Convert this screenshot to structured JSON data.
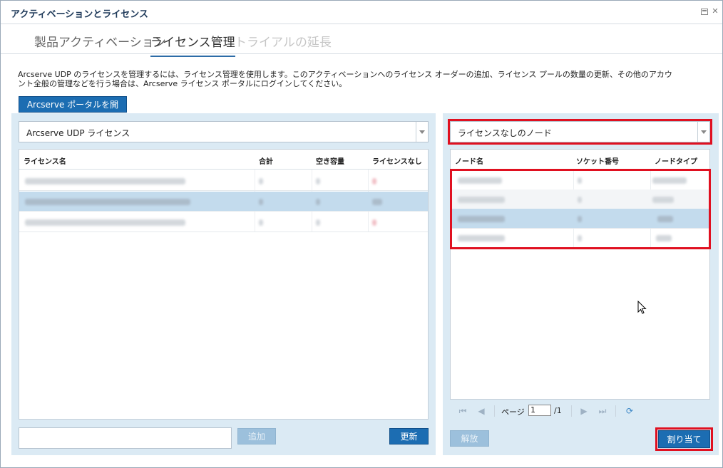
{
  "window": {
    "title": "アクティベーションとライセンス"
  },
  "tabs": [
    {
      "label": "製品アクティベーション"
    },
    {
      "label": "ライセンス管理"
    },
    {
      "label": "トライアルの延長"
    }
  ],
  "description": "Arcserve UDP のライセンスを管理するには、ライセンス管理を使用します。このアクティベーションへのライセンス オーダーの追加、ライセンス プールの数量の更新、その他のアカウント全般の管理などを行う場合は、Arcserve ライセンス ポータルにログインしてください。",
  "portal_button": "Arcserve ポータルを開く",
  "left": {
    "combo_value": "Arcserve UDP ライセンス",
    "columns": [
      "ライセンス名",
      "合計",
      "空き容量",
      "ライセンスなし"
    ],
    "input_value": "",
    "add_label": "追加",
    "update_label": "更新"
  },
  "right": {
    "combo_value": "ライセンスなしのノード",
    "columns": [
      "ノード名",
      "ソケット番号",
      "ノードタイプ"
    ],
    "pager": {
      "page_label": "ページ",
      "page_value": "1",
      "total": "/1"
    },
    "release_label": "解放",
    "assign_label": "割り当て"
  },
  "colors": {
    "accent": "#1c6db2",
    "highlight": "#e01020",
    "selection": "#c3dbed",
    "panel": "#dbeaf4"
  }
}
